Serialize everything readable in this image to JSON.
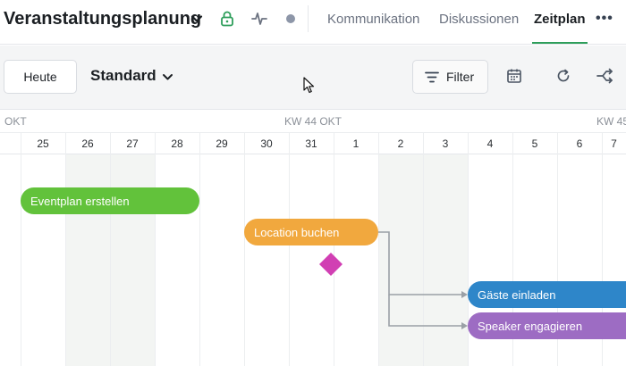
{
  "header": {
    "project_title": "Veranstaltungsplanung",
    "tabs": [
      {
        "label": "Kommunikation",
        "active": false
      },
      {
        "label": "Diskussionen",
        "active": false
      },
      {
        "label": "Zeitplan",
        "active": true
      }
    ],
    "more_label": "•••"
  },
  "toolbar": {
    "today_label": "Heute",
    "view_label": "Standard",
    "filter_label": "Filter"
  },
  "timeline": {
    "week_labels": [
      "OKT",
      "KW 44 OKT",
      "KW 45"
    ],
    "days": [
      "25",
      "26",
      "27",
      "28",
      "29",
      "30",
      "31",
      "1",
      "2",
      "3",
      "4",
      "5",
      "6",
      "7"
    ],
    "tasks": [
      {
        "label": "Eventplan erstellen"
      },
      {
        "label": "Location buchen"
      },
      {
        "label": "Gäste einladen"
      },
      {
        "label": "Speaker engagieren"
      }
    ]
  },
  "colors": {
    "accent_green": "#2e9e5b",
    "task_green": "#62c23b",
    "task_orange": "#f1a83e",
    "task_blue": "#2e86c9",
    "task_purple": "#9d6cc3",
    "milestone_magenta": "#d13fb3"
  },
  "icons": {
    "title_caret": "chevron-down-icon",
    "lock": "lock-icon",
    "activity": "activity-icon",
    "status": "status-dot-icon",
    "filter": "filter-icon",
    "calendar": "calendar-icon",
    "refresh": "refresh-icon",
    "share": "share-icon"
  }
}
